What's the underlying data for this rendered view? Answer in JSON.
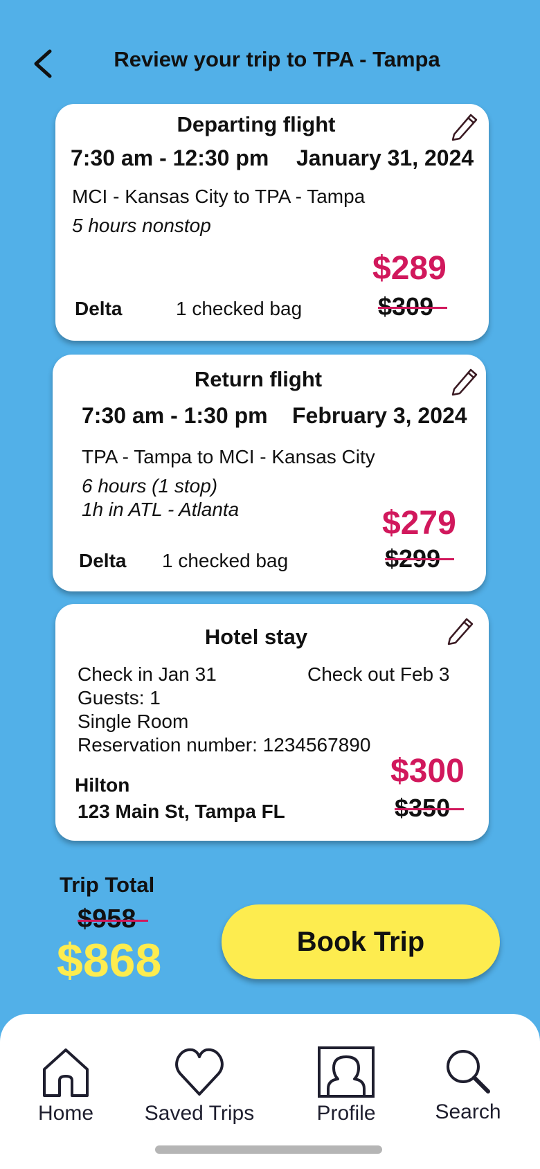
{
  "header": {
    "title": "Review your trip to TPA - Tampa",
    "back_icon": "chevron-left-icon"
  },
  "departing": {
    "title": "Departing flight",
    "times": "7:30 am - 12:30 pm",
    "date": "January 31, 2024",
    "route": "MCI - Kansas City to TPA - Tampa",
    "duration": "5 hours nonstop",
    "airline": "Delta",
    "bags": "1 checked bag",
    "price": "$289",
    "old_price": "$309"
  },
  "return": {
    "title": "Return flight",
    "times": "7:30 am - 1:30 pm",
    "date": "February 3, 2024",
    "route": "TPA - Tampa to MCI - Kansas City",
    "duration": "6 hours (1 stop)",
    "layover": "1h in ATL - Atlanta",
    "airline": "Delta",
    "bags": "1 checked bag",
    "price": "$279",
    "old_price": "$299"
  },
  "hotel": {
    "title": "Hotel stay",
    "check_in": "Check in Jan 31",
    "check_out": "Check out Feb 3",
    "guests": "Guests: 1",
    "room": "Single Room",
    "reservation": "Reservation number: 1234567890",
    "name": "Hilton",
    "address": "123 Main St, Tampa FL",
    "price": "$300",
    "old_price": "$350"
  },
  "total": {
    "label": "Trip Total",
    "old_price": "$958",
    "price": "$868"
  },
  "book_button": "Book Trip",
  "nav": {
    "items": [
      {
        "label": "Home",
        "icon": "home-icon"
      },
      {
        "label": "Saved Trips",
        "icon": "heart-icon"
      },
      {
        "label": "Profile",
        "icon": "profile-icon"
      },
      {
        "label": "Search",
        "icon": "search-icon"
      }
    ]
  },
  "colors": {
    "background": "#52b0e8",
    "price_accent": "#d1185c",
    "total_accent": "#fdec4f",
    "button": "#fdec4f"
  }
}
